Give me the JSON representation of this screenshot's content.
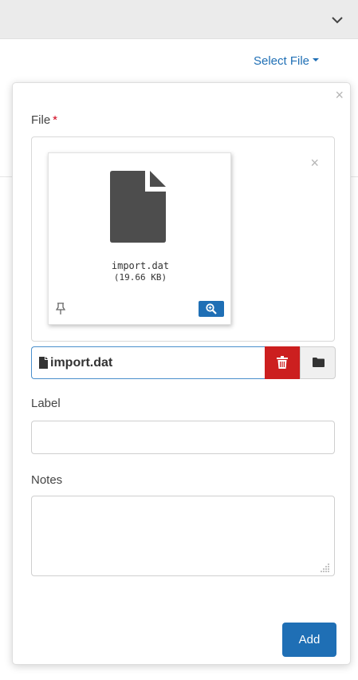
{
  "header": {
    "chevron_icon": "chevron-down-icon"
  },
  "toolbar": {
    "select_file_label": "Select File"
  },
  "panel": {
    "close_label": "×",
    "file_field": {
      "label": "File",
      "required_marker": "*"
    },
    "preview": {
      "close_label": "×",
      "file_name": "import.dat",
      "file_size": "(19.66 KB)",
      "icons": [
        "file-icon",
        "pin-icon",
        "zoom-icon"
      ]
    },
    "file_input": {
      "value": "import.dat",
      "icons": [
        "file-icon",
        "trash-icon",
        "folder-icon"
      ]
    },
    "label_field": {
      "label": "Label",
      "value": ""
    },
    "notes_field": {
      "label": "Notes",
      "value": ""
    },
    "add_button_label": "Add"
  },
  "colors": {
    "accent": "#1f6fb5",
    "danger": "#cc1f1f",
    "required": "#d0021b",
    "topbar": "#ebebeb"
  }
}
